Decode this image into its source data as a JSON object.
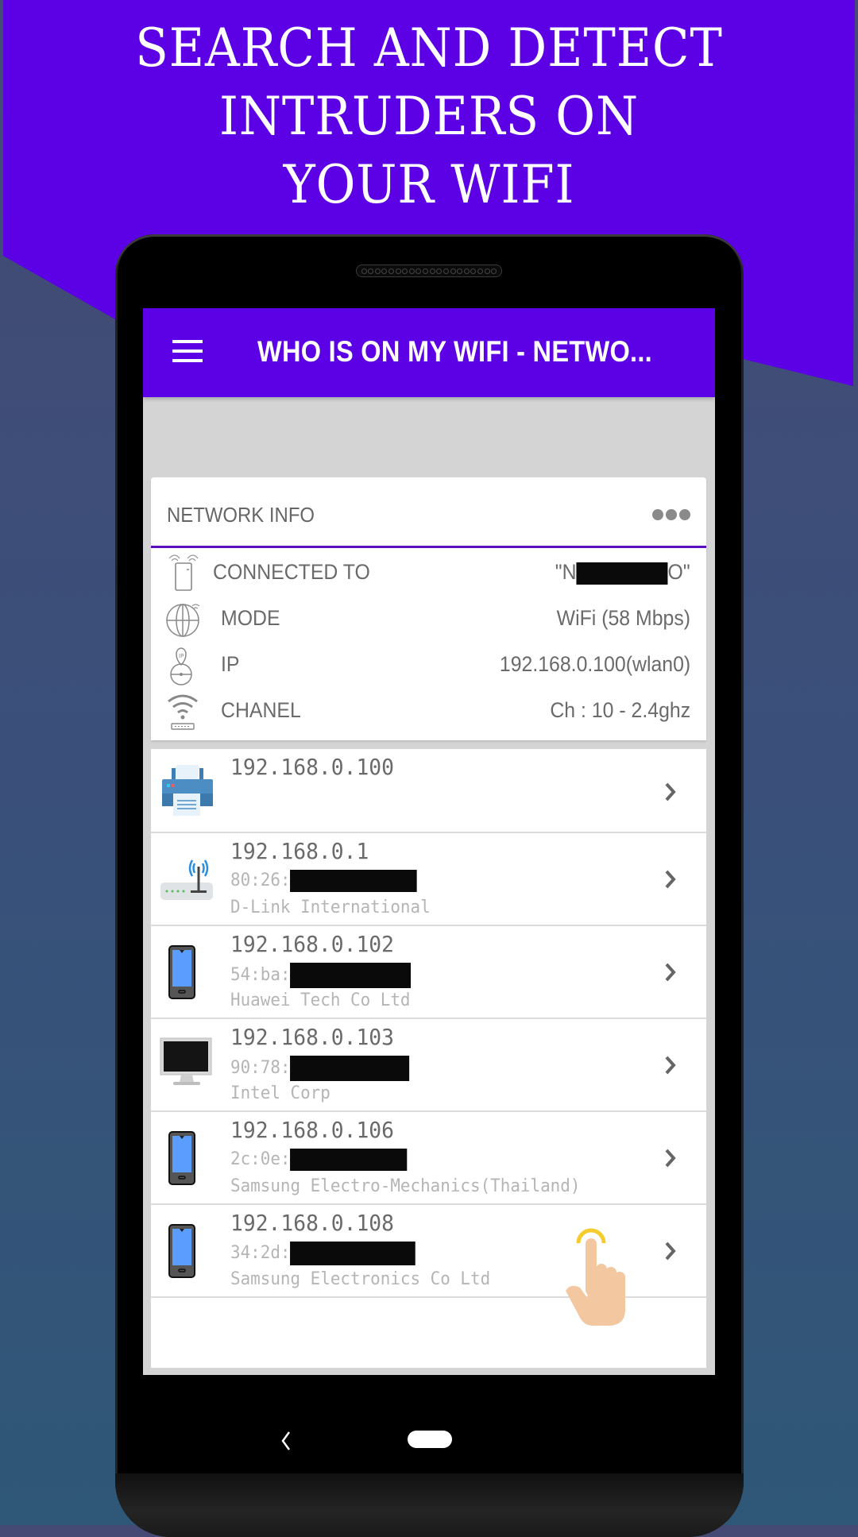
{
  "promo": {
    "lines": [
      "SEARCH AND DETECT",
      "INTRUDERS ON",
      "YOUR WIFI"
    ]
  },
  "colors": {
    "accent": "#5c00e6",
    "fab": "#0fd6c2",
    "divider": "#5c0cc0"
  },
  "appbar": {
    "title": "WHO IS ON MY WIFI - NETWO...",
    "menu_icon": "hamburger-menu-icon"
  },
  "network_info": {
    "title": "NETWORK INFO",
    "more_icon": "more-horizontal-icon",
    "rows": [
      {
        "icon": "router-icon",
        "label": "CONNECTED TO",
        "value_prefix": "\"N",
        "value_suffix": "O\"",
        "redacted": true
      },
      {
        "icon": "globe-icon",
        "label": "MODE",
        "value": "WiFi (58 Mbps)"
      },
      {
        "icon": "ip-location-icon",
        "label": "IP",
        "value": "192.168.0.100(wlan0)"
      },
      {
        "icon": "wifi-router-icon",
        "label": "CHANEL",
        "value": "Ch : 10 - 2.4ghz"
      }
    ]
  },
  "devices": [
    {
      "icon": "printer-icon",
      "ip": "192.168.0.100",
      "mac_prefix": "",
      "vendor": ""
    },
    {
      "icon": "wireless-router-icon",
      "ip": "192.168.0.1",
      "mac_prefix": "80:26:",
      "vendor": "D-Link International"
    },
    {
      "icon": "smartphone-icon",
      "ip": "192.168.0.102",
      "mac_prefix": "54:ba:",
      "vendor": "Huawei Tech Co Ltd"
    },
    {
      "icon": "monitor-icon",
      "ip": "192.168.0.103",
      "mac_prefix": "90:78:",
      "vendor": "Intel Corp"
    },
    {
      "icon": "smartphone-icon",
      "ip": "192.168.0.106",
      "mac_prefix": "2c:0e:",
      "vendor": "Samsung Electro-Mechanics(Thailand)"
    },
    {
      "icon": "smartphone-icon",
      "ip": "192.168.0.108",
      "mac_prefix": "34:2d:",
      "vendor": "Samsung Electronics Co Ltd"
    }
  ],
  "fab": {
    "icon": "search-icon"
  },
  "navbar": {
    "back_icon": "back-icon",
    "home_icon": "home-pill-icon"
  }
}
